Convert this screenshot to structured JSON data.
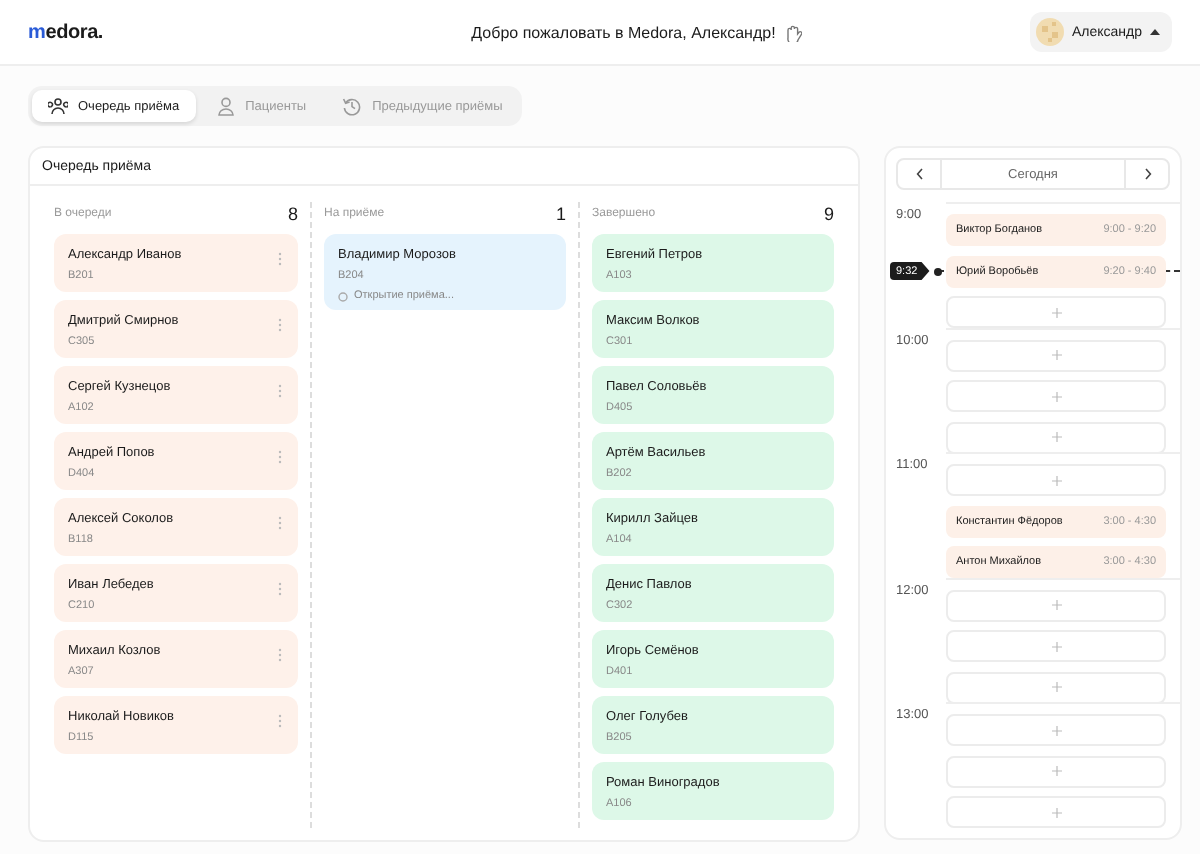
{
  "header": {
    "logo": "medora.",
    "greeting": "Добро пожаловать в Medora, Александр!",
    "user": "Александр"
  },
  "tabs": [
    {
      "label": "Очередь приёма",
      "selected": true
    },
    {
      "label": "Пациенты",
      "selected": false
    },
    {
      "label": "Предыдущие приёмы",
      "selected": false
    }
  ],
  "board": {
    "title": "Очередь приёма",
    "columns": [
      {
        "kind": "waiting",
        "title": "В очереди",
        "count": "8",
        "cards": [
          {
            "name": "Александр Иванов",
            "room": "B201"
          },
          {
            "name": "Дмитрий Смирнов",
            "room": "C305"
          },
          {
            "name": "Сергей Кузнецов",
            "room": "A102"
          },
          {
            "name": "Андрей Попов",
            "room": "D404"
          },
          {
            "name": "Алексей Соколов",
            "room": "B118"
          },
          {
            "name": "Иван Лебедев",
            "room": "C210"
          },
          {
            "name": "Михаил Козлов",
            "room": "A307"
          },
          {
            "name": "Николай Новиков",
            "room": "D115"
          }
        ]
      },
      {
        "kind": "active",
        "title": "На приёме",
        "count": "1",
        "cards": [
          {
            "name": "Владимир Морозов",
            "room": "B204",
            "status": "Открытие приёма..."
          }
        ]
      },
      {
        "kind": "done",
        "title": "Завершено",
        "count": "9",
        "cards": [
          {
            "name": "Евгений Петров",
            "room": "A103"
          },
          {
            "name": "Максим Волков",
            "room": "C301"
          },
          {
            "name": "Павел Соловьёв",
            "room": "D405"
          },
          {
            "name": "Артём Васильев",
            "room": "B202"
          },
          {
            "name": "Кирилл Зайцев",
            "room": "A104"
          },
          {
            "name": "Денис Павлов",
            "room": "C302"
          },
          {
            "name": "Игорь Семёнов",
            "room": "D401"
          },
          {
            "name": "Олег Голубев",
            "room": "B205"
          },
          {
            "name": "Роман Виноградов",
            "room": "A106"
          }
        ]
      }
    ]
  },
  "schedule": {
    "day": "Сегодня",
    "now": "9:32",
    "hours": [
      {
        "label": "9:00",
        "slots": [
          {
            "kind": "booked",
            "name": "Виктор Богданов",
            "time": "9:00 - 9:20"
          },
          {
            "kind": "booked",
            "name": "Юрий Воробьёв",
            "time": "9:20 - 9:40"
          },
          {
            "kind": "empty"
          }
        ]
      },
      {
        "label": "10:00",
        "slots": [
          {
            "kind": "empty"
          },
          {
            "kind": "empty"
          },
          {
            "kind": "empty"
          }
        ]
      },
      {
        "label": "11:00",
        "slots": [
          {
            "kind": "empty"
          },
          {
            "kind": "booked",
            "name": "Константин Фёдоров",
            "time": "3:00 - 4:30"
          },
          {
            "kind": "booked",
            "name": "Антон Михайлов",
            "time": "3:00 - 4:30"
          }
        ]
      },
      {
        "label": "12:00",
        "slots": [
          {
            "kind": "empty"
          },
          {
            "kind": "empty"
          },
          {
            "kind": "empty"
          }
        ]
      },
      {
        "label": "13:00",
        "slots": [
          {
            "kind": "empty"
          },
          {
            "kind": "empty"
          },
          {
            "kind": "empty"
          }
        ]
      }
    ]
  }
}
